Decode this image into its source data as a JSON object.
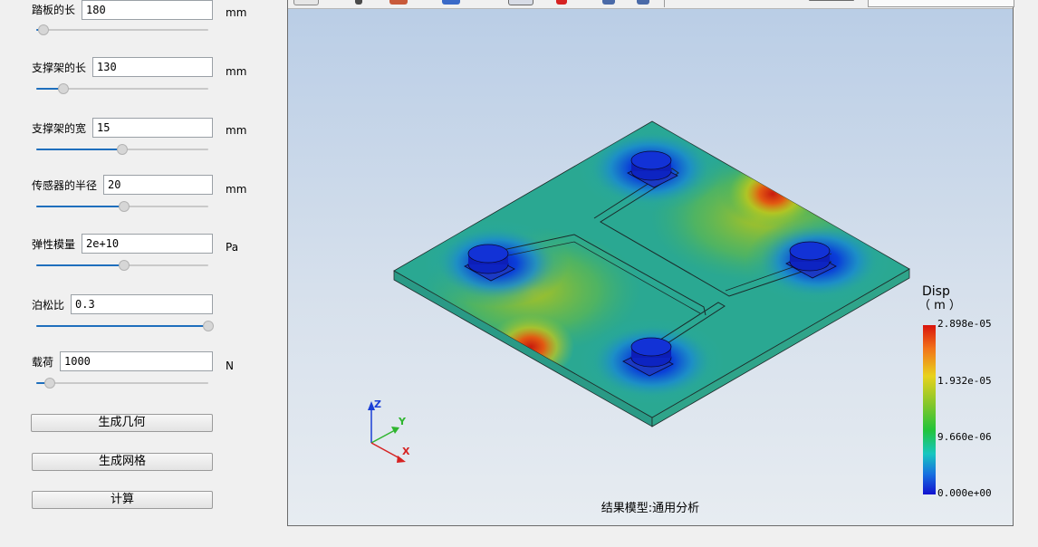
{
  "params": [
    {
      "label": "踏板的长",
      "value": "180",
      "unit": "mm",
      "slider": 0.04
    },
    {
      "label": "支撑架的长",
      "value": "130",
      "unit": "mm",
      "slider": 0.16
    },
    {
      "label": "支撑架的宽",
      "value": "15",
      "unit": "mm",
      "slider": 0.5
    },
    {
      "label": "传感器的半径",
      "value": "20",
      "unit": "mm",
      "slider": 0.51
    },
    {
      "label": "弹性模量",
      "value": "2e+10",
      "unit": "Pa",
      "slider": 0.51
    },
    {
      "label": "泊松比",
      "value": "0.3",
      "unit": "",
      "slider": 1.0
    },
    {
      "label": "载荷",
      "value": "1000",
      "unit": "N",
      "slider": 0.08
    }
  ],
  "buttons": {
    "generate_geometry": "生成几何",
    "generate_mesh": "生成网格",
    "compute": "计算"
  },
  "viewport": {
    "status_text": "结果模型:通用分析",
    "axes": {
      "z": "Z",
      "y": "Y",
      "x": "X"
    },
    "legend": {
      "title": "Disp",
      "unit": "（ m ）",
      "values": [
        "2.898e-05",
        "1.932e-05",
        "9.660e-06",
        "0.000e+00"
      ]
    }
  },
  "colors": {
    "slider_fill": "#1f6fbd",
    "axis_z": "#1a3fd6",
    "axis_y": "#2fb52f",
    "axis_x": "#d62222"
  }
}
